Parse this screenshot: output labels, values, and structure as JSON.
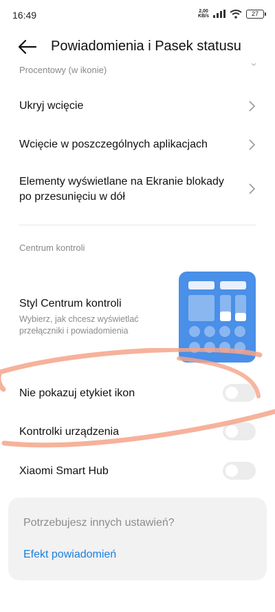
{
  "status_bar": {
    "time": "16:49",
    "speed_value": "2,00",
    "speed_unit": "KB/s",
    "battery": "27"
  },
  "header": {
    "title": "Powiadomienia i Pasek statusu"
  },
  "partial_item": {
    "subtitle": "Procentowy (w ikonie)"
  },
  "nav_items": [
    {
      "label": "Ukryj wcięcie"
    },
    {
      "label": "Wcięcie w poszczególnych aplikacjach"
    },
    {
      "label_line1": "Elementy wyświetlane na Ekranie blokady",
      "label_line2": "po przesunięciu w dół"
    }
  ],
  "control_center": {
    "section_title": "Centrum kontroli",
    "style_title": "Styl Centrum kontroli",
    "style_description": "Wybierz, jak chcesz wyświetlać przełączniki i powiadomienia"
  },
  "toggles": [
    {
      "label": "Nie pokazuj etykiet ikon",
      "state": "off"
    },
    {
      "label": "Kontrolki urządzenia",
      "state": "off"
    },
    {
      "label": "Xiaomi Smart Hub",
      "state": "off"
    }
  ],
  "suggestion_card": {
    "title": "Potrzebujesz innych ustawień?",
    "link": "Efekt powiadomień"
  },
  "colors": {
    "accent_link": "#1a7fdd",
    "thumbnail_blue": "#4a8fe8",
    "annotation_stroke": "#f4a48a"
  }
}
